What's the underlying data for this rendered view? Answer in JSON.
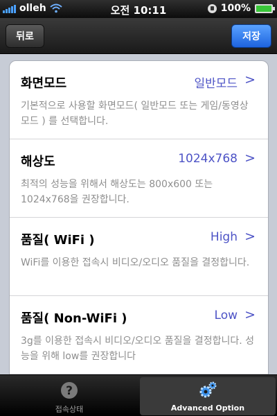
{
  "status_bar": {
    "carrier": "olleh",
    "time": "오전 10:11",
    "battery": "100%"
  },
  "navbar": {
    "back_label": "뒤로",
    "save_label": "저장"
  },
  "settings": [
    {
      "title": "화면모드",
      "value": "일반모드",
      "chevron": ">",
      "description": "기본적으로 사용할 화면모드( 일반모드 또는 게임/동영상 모드 ) 를 선택합니다."
    },
    {
      "title": "해상도",
      "value": "1024x768",
      "chevron": ">",
      "description": "최적의 성능을 위해서 해상도는 800x600 또는 1024x768을 권장합니다."
    },
    {
      "title": "품질( WiFi )",
      "value": "High",
      "chevron": ">",
      "description": "WiFi를 이용한 접속시 비디오/오디오 품질을 결정합니다."
    },
    {
      "title": "품질( Non-WiFi )",
      "value": "Low",
      "chevron": ">",
      "description": "3g를 이용한 접속시 비디오/오디오 품질을 결정합니다. 성능을 위해 low를 권장합니다"
    }
  ],
  "tabbar": {
    "tabs": [
      {
        "label": "접속상태",
        "icon": "question-icon",
        "selected": false
      },
      {
        "label": "Advanced Option",
        "icon": "gears-icon",
        "selected": true
      }
    ]
  },
  "colors": {
    "accent": "#4d53c6",
    "save_button": "#1d63df",
    "description": "#8e8e8e"
  }
}
